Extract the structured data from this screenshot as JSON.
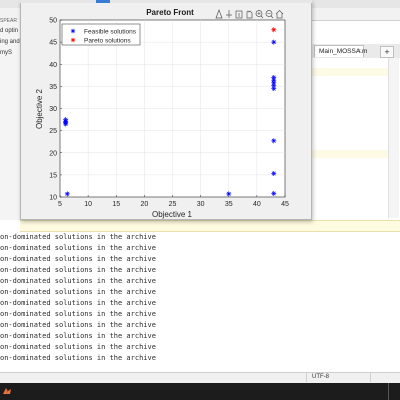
{
  "left_panel": {
    "fragments": [
      "SPEAR",
      "d optin",
      "ing and",
      "myS"
    ]
  },
  "editor": {
    "tab_label": "Main_MOSSA.m",
    "tab_close": "×",
    "new_tab": "+"
  },
  "command_window": {
    "lines": [
      "on-dominated solutions in the archive",
      "on-dominated solutions in the archive",
      "on-dominated solutions in the archive",
      "on-dominated solutions in the archive",
      "on-dominated solutions in the archive",
      "on-dominated solutions in the archive",
      "on-dominated solutions in the archive",
      "on-dominated solutions in the archive",
      "on-dominated solutions in the archive",
      "on-dominated solutions in the archive",
      "on-dominated solutions in the archive",
      "on-dominated solutions in the archive"
    ]
  },
  "status_bar": {
    "encoding": "UTF-8"
  },
  "figure": {
    "toolbar_icons": [
      "brush-icon",
      "data-cursor-icon",
      "export-icon",
      "pan-icon",
      "zoom-in-icon",
      "zoom-out-icon",
      "home-icon"
    ]
  },
  "chart_data": {
    "type": "scatter",
    "title": "Pareto Front",
    "xlabel": "Objective 1",
    "ylabel": "Objective 2",
    "xlim": [
      5,
      45
    ],
    "ylim": [
      10,
      50
    ],
    "xticks": [
      5,
      10,
      15,
      20,
      25,
      30,
      35,
      40,
      45
    ],
    "yticks": [
      10,
      15,
      20,
      25,
      30,
      35,
      40,
      45,
      50
    ],
    "grid": true,
    "legend_position": "top-left",
    "series": [
      {
        "name": "Feasible solutions",
        "color": "#0000ff",
        "marker": "*",
        "points": [
          [
            6,
            27.5
          ],
          [
            6,
            27
          ],
          [
            6,
            26.8
          ],
          [
            6,
            26.5
          ],
          [
            6.3,
            10.7
          ],
          [
            35,
            10.7
          ],
          [
            43,
            10.8
          ],
          [
            43,
            15.3
          ],
          [
            43,
            22.7
          ],
          [
            43,
            34.5
          ],
          [
            43,
            35.2
          ],
          [
            43,
            35.8
          ],
          [
            43,
            36.4
          ],
          [
            43,
            37
          ],
          [
            43,
            45
          ]
        ]
      },
      {
        "name": "Pareto solutions",
        "color": "#ff0000",
        "marker": "*",
        "points": [
          [
            43,
            47.8
          ]
        ]
      }
    ]
  }
}
